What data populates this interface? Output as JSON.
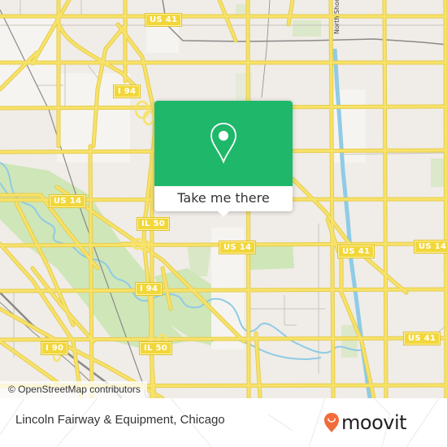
{
  "map": {
    "colors": {
      "background": "#f0ece7",
      "road_major": "#f7e26a",
      "road_outline": "#e6cc4a",
      "road_minor": "#c9c3bd",
      "water": "#8fcbe6",
      "park": "#cfe6b8",
      "rail": "#8a8a8a"
    },
    "route_shields": [
      {
        "label": "US 41"
      },
      {
        "label": "I 94"
      },
      {
        "label": "US 14"
      },
      {
        "label": "IL 50"
      },
      {
        "label": "US 14"
      },
      {
        "label": "US 41"
      },
      {
        "label": "US 14"
      },
      {
        "label": "I 94"
      },
      {
        "label": "US 41"
      },
      {
        "label": "I 90"
      },
      {
        "label": "IL 50"
      }
    ],
    "street_labels": [
      {
        "label": "North Shore"
      }
    ],
    "attribution": "© OpenStreetMap contributors"
  },
  "popup": {
    "icon": "location-pin-icon",
    "action_label": "Take me there",
    "accent_color": "#1fb86a"
  },
  "footer": {
    "place_name": "Lincoln Fairway & Equipment, Chicago",
    "brand": {
      "name": "moovit",
      "logo_icon": "moovit-smiley-pin-icon",
      "logo_color": "#f26b3a"
    }
  }
}
